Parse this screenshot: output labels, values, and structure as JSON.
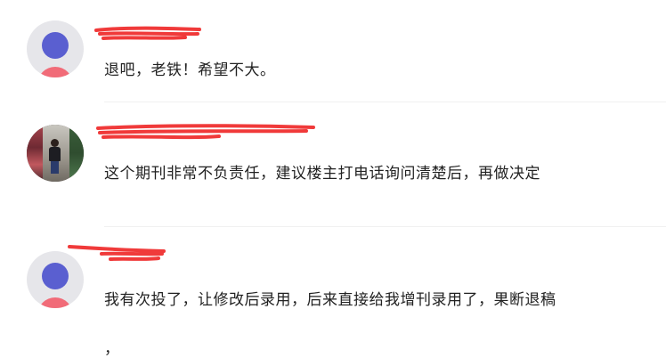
{
  "comments": [
    {
      "username": "",
      "content": "退吧，老铁！希望不大。",
      "avatar": "default-avatar"
    },
    {
      "username": "",
      "content": "这个期刊非常不负责任，建议楼主打电话询问清楚后，再做决定",
      "avatar": "photo-avatar"
    },
    {
      "username": "",
      "content": "我有次投了，让修改后录用，后来直接给我增刊录用了，果断退稿",
      "content_tail": "，",
      "avatar": "default-avatar"
    }
  ],
  "colors": {
    "redaction": "#f03a3a",
    "text": "#222222",
    "avatar_bg": "#e6e6ea",
    "avatar_head": "#5a5fd0",
    "avatar_body": "#f16b78"
  }
}
